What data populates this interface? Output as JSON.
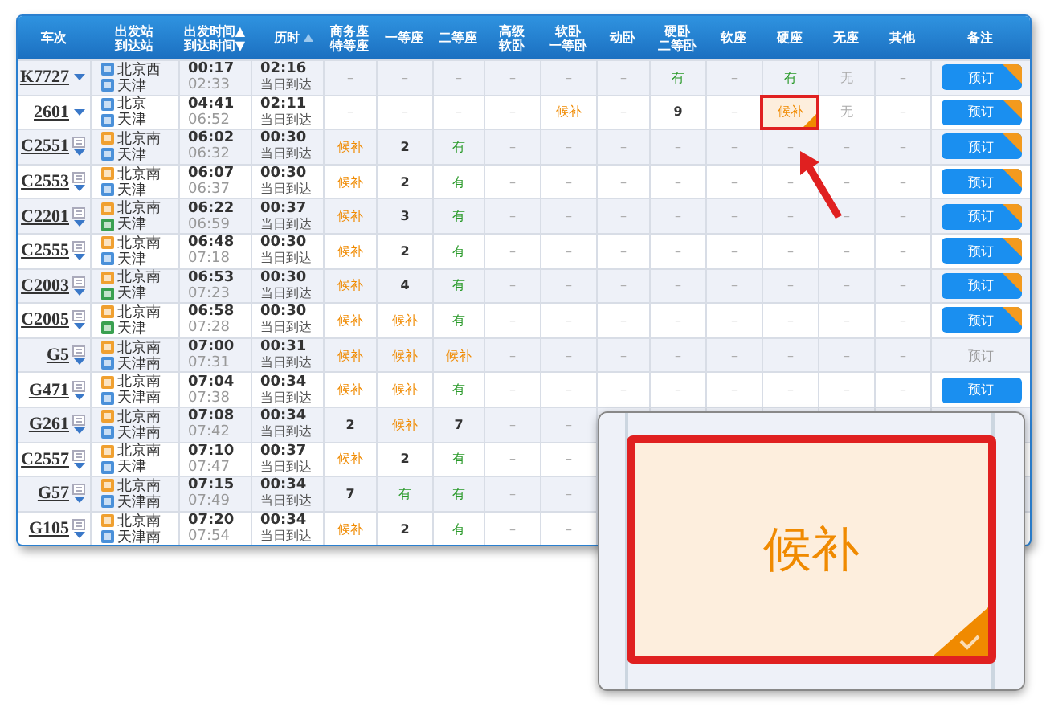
{
  "table": {
    "columns": [
      {
        "lines": [
          "车次"
        ]
      },
      {
        "lines": [
          "出发站",
          "到达站"
        ]
      },
      {
        "lines": [
          "出发时间▲",
          "到达时间▼"
        ]
      },
      {
        "lines": [
          "历时"
        ],
        "sortable": true
      },
      {
        "lines": [
          "商务座",
          "特等座"
        ]
      },
      {
        "lines": [
          "一等座"
        ]
      },
      {
        "lines": [
          "二等座"
        ]
      },
      {
        "lines": [
          "高级",
          "软卧"
        ]
      },
      {
        "lines": [
          "软卧",
          "一等卧"
        ]
      },
      {
        "lines": [
          "动卧"
        ]
      },
      {
        "lines": [
          "硬卧",
          "二等卧"
        ]
      },
      {
        "lines": [
          "软座"
        ]
      },
      {
        "lines": [
          "硬座"
        ]
      },
      {
        "lines": [
          "无座"
        ]
      },
      {
        "lines": [
          "其他"
        ]
      },
      {
        "lines": [
          "备注"
        ]
      }
    ],
    "rows": [
      {
        "train": "K7727",
        "info_icon": false,
        "from": {
          "name": "北京西",
          "kind": "pass"
        },
        "to": {
          "name": "天津",
          "kind": "pass"
        },
        "depart": "00:17",
        "arrive": "02:33",
        "duration": "02:16",
        "arrival_note": "当日到达",
        "seats": [
          {
            "text": "–",
            "kind": "none",
            "selected": false
          },
          {
            "text": "–",
            "kind": "none",
            "selected": false
          },
          {
            "text": "–",
            "kind": "none",
            "selected": false
          },
          {
            "text": "–",
            "kind": "none",
            "selected": false
          },
          {
            "text": "–",
            "kind": "none",
            "selected": false
          },
          {
            "text": "–",
            "kind": "none",
            "selected": false
          },
          {
            "text": "有",
            "kind": "available",
            "selected": false
          },
          {
            "text": "–",
            "kind": "none",
            "selected": false
          },
          {
            "text": "有",
            "kind": "available",
            "selected": false
          },
          {
            "text": "无",
            "kind": "none",
            "selected": false
          },
          {
            "text": "–",
            "kind": "none",
            "selected": false
          }
        ],
        "booking": {
          "label": "预订",
          "disabled": false,
          "badge": true
        }
      },
      {
        "train": "2601",
        "info_icon": false,
        "from": {
          "name": "北京",
          "kind": "pass"
        },
        "to": {
          "name": "天津",
          "kind": "pass"
        },
        "depart": "04:41",
        "arrive": "06:52",
        "duration": "02:11",
        "arrival_note": "当日到达",
        "seats": [
          {
            "text": "–",
            "kind": "none",
            "selected": false
          },
          {
            "text": "–",
            "kind": "none",
            "selected": false
          },
          {
            "text": "–",
            "kind": "none",
            "selected": false
          },
          {
            "text": "–",
            "kind": "none",
            "selected": false
          },
          {
            "text": "候补",
            "kind": "waitlist",
            "selected": false
          },
          {
            "text": "–",
            "kind": "none",
            "selected": false
          },
          {
            "text": "9",
            "kind": "count",
            "selected": false
          },
          {
            "text": "–",
            "kind": "none",
            "selected": false
          },
          {
            "text": "候补",
            "kind": "waitlist",
            "selected": true
          },
          {
            "text": "无",
            "kind": "none",
            "selected": false
          },
          {
            "text": "–",
            "kind": "none",
            "selected": false
          }
        ],
        "booking": {
          "label": "预订",
          "disabled": false,
          "badge": true
        }
      },
      {
        "train": "C2551",
        "info_icon": true,
        "from": {
          "name": "北京南",
          "kind": "start"
        },
        "to": {
          "name": "天津",
          "kind": "pass"
        },
        "depart": "06:02",
        "arrive": "06:32",
        "duration": "00:30",
        "arrival_note": "当日到达",
        "seats": [
          {
            "text": "候补",
            "kind": "waitlist",
            "selected": false
          },
          {
            "text": "2",
            "kind": "count",
            "selected": false
          },
          {
            "text": "有",
            "kind": "available",
            "selected": false
          },
          {
            "text": "–",
            "kind": "none",
            "selected": false
          },
          {
            "text": "–",
            "kind": "none",
            "selected": false
          },
          {
            "text": "–",
            "kind": "none",
            "selected": false
          },
          {
            "text": "–",
            "kind": "none",
            "selected": false
          },
          {
            "text": "–",
            "kind": "none",
            "selected": false
          },
          {
            "text": "–",
            "kind": "none",
            "selected": false
          },
          {
            "text": "–",
            "kind": "none",
            "selected": false
          },
          {
            "text": "–",
            "kind": "none",
            "selected": false
          }
        ],
        "booking": {
          "label": "预订",
          "disabled": false,
          "badge": true
        }
      },
      {
        "train": "C2553",
        "info_icon": true,
        "from": {
          "name": "北京南",
          "kind": "start"
        },
        "to": {
          "name": "天津",
          "kind": "pass"
        },
        "depart": "06:07",
        "arrive": "06:37",
        "duration": "00:30",
        "arrival_note": "当日到达",
        "seats": [
          {
            "text": "候补",
            "kind": "waitlist",
            "selected": false
          },
          {
            "text": "2",
            "kind": "count",
            "selected": false
          },
          {
            "text": "有",
            "kind": "available",
            "selected": false
          },
          {
            "text": "–",
            "kind": "none",
            "selected": false
          },
          {
            "text": "–",
            "kind": "none",
            "selected": false
          },
          {
            "text": "–",
            "kind": "none",
            "selected": false
          },
          {
            "text": "–",
            "kind": "none",
            "selected": false
          },
          {
            "text": "–",
            "kind": "none",
            "selected": false
          },
          {
            "text": "–",
            "kind": "none",
            "selected": false
          },
          {
            "text": "–",
            "kind": "none",
            "selected": false
          },
          {
            "text": "–",
            "kind": "none",
            "selected": false
          }
        ],
        "booking": {
          "label": "预订",
          "disabled": false,
          "badge": true
        }
      },
      {
        "train": "C2201",
        "info_icon": true,
        "from": {
          "name": "北京南",
          "kind": "start"
        },
        "to": {
          "name": "天津",
          "kind": "end"
        },
        "depart": "06:22",
        "arrive": "06:59",
        "duration": "00:37",
        "arrival_note": "当日到达",
        "seats": [
          {
            "text": "候补",
            "kind": "waitlist",
            "selected": false
          },
          {
            "text": "3",
            "kind": "count",
            "selected": false
          },
          {
            "text": "有",
            "kind": "available",
            "selected": false
          },
          {
            "text": "–",
            "kind": "none",
            "selected": false
          },
          {
            "text": "–",
            "kind": "none",
            "selected": false
          },
          {
            "text": "–",
            "kind": "none",
            "selected": false
          },
          {
            "text": "–",
            "kind": "none",
            "selected": false
          },
          {
            "text": "–",
            "kind": "none",
            "selected": false
          },
          {
            "text": "–",
            "kind": "none",
            "selected": false
          },
          {
            "text": "–",
            "kind": "none",
            "selected": false
          },
          {
            "text": "–",
            "kind": "none",
            "selected": false
          }
        ],
        "booking": {
          "label": "预订",
          "disabled": false,
          "badge": true
        }
      },
      {
        "train": "C2555",
        "info_icon": true,
        "from": {
          "name": "北京南",
          "kind": "start"
        },
        "to": {
          "name": "天津",
          "kind": "pass"
        },
        "depart": "06:48",
        "arrive": "07:18",
        "duration": "00:30",
        "arrival_note": "当日到达",
        "seats": [
          {
            "text": "候补",
            "kind": "waitlist",
            "selected": false
          },
          {
            "text": "2",
            "kind": "count",
            "selected": false
          },
          {
            "text": "有",
            "kind": "available",
            "selected": false
          },
          {
            "text": "–",
            "kind": "none",
            "selected": false
          },
          {
            "text": "–",
            "kind": "none",
            "selected": false
          },
          {
            "text": "–",
            "kind": "none",
            "selected": false
          },
          {
            "text": "–",
            "kind": "none",
            "selected": false
          },
          {
            "text": "–",
            "kind": "none",
            "selected": false
          },
          {
            "text": "–",
            "kind": "none",
            "selected": false
          },
          {
            "text": "–",
            "kind": "none",
            "selected": false
          },
          {
            "text": "–",
            "kind": "none",
            "selected": false
          }
        ],
        "booking": {
          "label": "预订",
          "disabled": false,
          "badge": true
        }
      },
      {
        "train": "C2003",
        "info_icon": true,
        "from": {
          "name": "北京南",
          "kind": "start"
        },
        "to": {
          "name": "天津",
          "kind": "end"
        },
        "depart": "06:53",
        "arrive": "07:23",
        "duration": "00:30",
        "arrival_note": "当日到达",
        "seats": [
          {
            "text": "候补",
            "kind": "waitlist",
            "selected": false
          },
          {
            "text": "4",
            "kind": "count",
            "selected": false
          },
          {
            "text": "有",
            "kind": "available",
            "selected": false
          },
          {
            "text": "–",
            "kind": "none",
            "selected": false
          },
          {
            "text": "–",
            "kind": "none",
            "selected": false
          },
          {
            "text": "–",
            "kind": "none",
            "selected": false
          },
          {
            "text": "–",
            "kind": "none",
            "selected": false
          },
          {
            "text": "–",
            "kind": "none",
            "selected": false
          },
          {
            "text": "–",
            "kind": "none",
            "selected": false
          },
          {
            "text": "–",
            "kind": "none",
            "selected": false
          },
          {
            "text": "–",
            "kind": "none",
            "selected": false
          }
        ],
        "booking": {
          "label": "预订",
          "disabled": false,
          "badge": true
        }
      },
      {
        "train": "C2005",
        "info_icon": true,
        "from": {
          "name": "北京南",
          "kind": "start"
        },
        "to": {
          "name": "天津",
          "kind": "end"
        },
        "depart": "06:58",
        "arrive": "07:28",
        "duration": "00:30",
        "arrival_note": "当日到达",
        "seats": [
          {
            "text": "候补",
            "kind": "waitlist",
            "selected": false
          },
          {
            "text": "候补",
            "kind": "waitlist",
            "selected": false
          },
          {
            "text": "有",
            "kind": "available",
            "selected": false
          },
          {
            "text": "–",
            "kind": "none",
            "selected": false
          },
          {
            "text": "–",
            "kind": "none",
            "selected": false
          },
          {
            "text": "–",
            "kind": "none",
            "selected": false
          },
          {
            "text": "–",
            "kind": "none",
            "selected": false
          },
          {
            "text": "–",
            "kind": "none",
            "selected": false
          },
          {
            "text": "–",
            "kind": "none",
            "selected": false
          },
          {
            "text": "–",
            "kind": "none",
            "selected": false
          },
          {
            "text": "–",
            "kind": "none",
            "selected": false
          }
        ],
        "booking": {
          "label": "预订",
          "disabled": false,
          "badge": true
        }
      },
      {
        "train": "G5",
        "info_icon": true,
        "from": {
          "name": "北京南",
          "kind": "start"
        },
        "to": {
          "name": "天津南",
          "kind": "pass"
        },
        "depart": "07:00",
        "arrive": "07:31",
        "duration": "00:31",
        "arrival_note": "当日到达",
        "seats": [
          {
            "text": "候补",
            "kind": "waitlist",
            "selected": false
          },
          {
            "text": "候补",
            "kind": "waitlist",
            "selected": false
          },
          {
            "text": "候补",
            "kind": "waitlist",
            "selected": false
          },
          {
            "text": "–",
            "kind": "none",
            "selected": false
          },
          {
            "text": "–",
            "kind": "none",
            "selected": false
          },
          {
            "text": "–",
            "kind": "none",
            "selected": false
          },
          {
            "text": "–",
            "kind": "none",
            "selected": false
          },
          {
            "text": "–",
            "kind": "none",
            "selected": false
          },
          {
            "text": "–",
            "kind": "none",
            "selected": false
          },
          {
            "text": "–",
            "kind": "none",
            "selected": false
          },
          {
            "text": "–",
            "kind": "none",
            "selected": false
          }
        ],
        "booking": {
          "label": "预订",
          "disabled": true,
          "badge": false
        }
      },
      {
        "train": "G471",
        "info_icon": true,
        "from": {
          "name": "北京南",
          "kind": "start"
        },
        "to": {
          "name": "天津南",
          "kind": "pass"
        },
        "depart": "07:04",
        "arrive": "07:38",
        "duration": "00:34",
        "arrival_note": "当日到达",
        "seats": [
          {
            "text": "候补",
            "kind": "waitlist",
            "selected": false
          },
          {
            "text": "候补",
            "kind": "waitlist",
            "selected": false
          },
          {
            "text": "有",
            "kind": "available",
            "selected": false
          },
          {
            "text": "–",
            "kind": "none",
            "selected": false
          },
          {
            "text": "–",
            "kind": "none",
            "selected": false
          },
          {
            "text": "–",
            "kind": "none",
            "selected": false
          },
          {
            "text": "–",
            "kind": "none",
            "selected": false
          },
          {
            "text": "–",
            "kind": "none",
            "selected": false
          },
          {
            "text": "–",
            "kind": "none",
            "selected": false
          },
          {
            "text": "–",
            "kind": "none",
            "selected": false
          },
          {
            "text": "–",
            "kind": "none",
            "selected": false
          }
        ],
        "booking": {
          "label": "预订",
          "disabled": false,
          "badge": false
        }
      },
      {
        "train": "G261",
        "info_icon": true,
        "from": {
          "name": "北京南",
          "kind": "start"
        },
        "to": {
          "name": "天津南",
          "kind": "pass"
        },
        "depart": "07:08",
        "arrive": "07:42",
        "duration": "00:34",
        "arrival_note": "当日到达",
        "seats": [
          {
            "text": "2",
            "kind": "count",
            "selected": false
          },
          {
            "text": "候补",
            "kind": "waitlist",
            "selected": false
          },
          {
            "text": "7",
            "kind": "count",
            "selected": false
          },
          {
            "text": "–",
            "kind": "none",
            "selected": false
          },
          {
            "text": "–",
            "kind": "none",
            "selected": false
          }
        ]
      },
      {
        "train": "C2557",
        "info_icon": true,
        "from": {
          "name": "北京南",
          "kind": "start"
        },
        "to": {
          "name": "天津",
          "kind": "pass"
        },
        "depart": "07:10",
        "arrive": "07:47",
        "duration": "00:37",
        "arrival_note": "当日到达",
        "seats": [
          {
            "text": "候补",
            "kind": "waitlist",
            "selected": false
          },
          {
            "text": "2",
            "kind": "count",
            "selected": false
          },
          {
            "text": "有",
            "kind": "available",
            "selected": false
          },
          {
            "text": "–",
            "kind": "none",
            "selected": false
          },
          {
            "text": "–",
            "kind": "none",
            "selected": false
          }
        ]
      },
      {
        "train": "G57",
        "info_icon": true,
        "from": {
          "name": "北京南",
          "kind": "start"
        },
        "to": {
          "name": "天津南",
          "kind": "pass"
        },
        "depart": "07:15",
        "arrive": "07:49",
        "duration": "00:34",
        "arrival_note": "当日到达",
        "seats": [
          {
            "text": "7",
            "kind": "count",
            "selected": false
          },
          {
            "text": "有",
            "kind": "available",
            "selected": false
          },
          {
            "text": "有",
            "kind": "available",
            "selected": false
          },
          {
            "text": "–",
            "kind": "none",
            "selected": false
          },
          {
            "text": "–",
            "kind": "none",
            "selected": false
          }
        ]
      },
      {
        "train": "G105",
        "info_icon": true,
        "from": {
          "name": "北京南",
          "kind": "start"
        },
        "to": {
          "name": "天津南",
          "kind": "pass"
        },
        "depart": "07:20",
        "arrive": "07:54",
        "duration": "00:34",
        "arrival_note": "当日到达",
        "seats": [
          {
            "text": "候补",
            "kind": "waitlist",
            "selected": false
          },
          {
            "text": "2",
            "kind": "count",
            "selected": false
          },
          {
            "text": "有",
            "kind": "available",
            "selected": false
          },
          {
            "text": "–",
            "kind": "none",
            "selected": false
          },
          {
            "text": "–",
            "kind": "none",
            "selected": false
          }
        ]
      }
    ]
  },
  "inset": {
    "text": "候补",
    "kind": "waitlist",
    "selected": true
  }
}
